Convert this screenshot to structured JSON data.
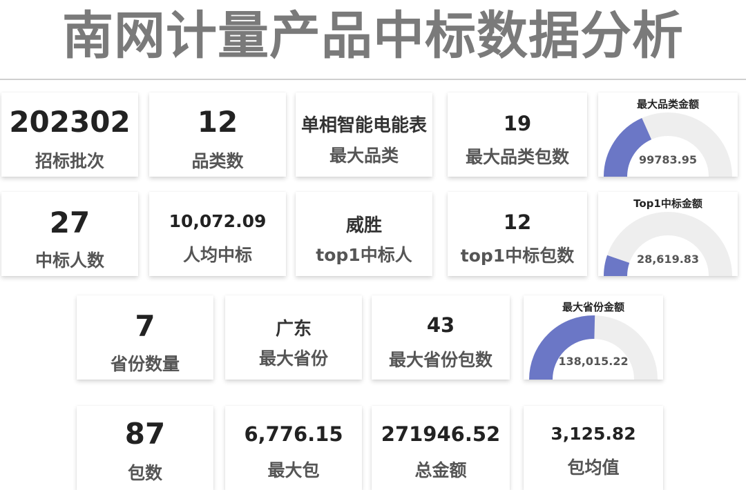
{
  "page": {
    "title": "南网计量产品中标数据分析"
  },
  "row1": [
    {
      "value": "202302",
      "label": "招标批次"
    },
    {
      "value": "12",
      "label": "品类数"
    },
    {
      "value": "单相智能电能表",
      "label": "最大品类"
    },
    {
      "value": "19",
      "label": "最大品类包数"
    }
  ],
  "row2": [
    {
      "value": "27",
      "label": "中标人数"
    },
    {
      "value": "10,072.09",
      "label": "人均中标"
    },
    {
      "value": "威胜",
      "label": "top1中标人"
    },
    {
      "value": "12",
      "label": "top1中标包数"
    }
  ],
  "row3": [
    {
      "value": "7",
      "label": "省份数量"
    },
    {
      "value": "广东",
      "label": "最大省份"
    },
    {
      "value": "43",
      "label": "最大省份包数"
    }
  ],
  "row4": [
    {
      "value": "87",
      "label": "包数"
    },
    {
      "value": "6,776.15",
      "label": "最大包"
    },
    {
      "value": "271946.52",
      "label": "总金额"
    },
    {
      "value": "3,125.82",
      "label": "包均值"
    }
  ],
  "chart_data": [
    {
      "type": "gauge",
      "title": "最大品类金额",
      "value_label": "99783.95",
      "value": 99783.95,
      "max": 271946.52,
      "fill_color": "#6b77c6",
      "track_color": "#eeeeee"
    },
    {
      "type": "gauge",
      "title": "Top1中标金额",
      "value_label": "28,619.83",
      "value": 28619.83,
      "max": 271946.52,
      "fill_color": "#6b77c6",
      "track_color": "#eeeeee"
    },
    {
      "type": "gauge",
      "title": "最大省份金额",
      "value_label": "138,015.22",
      "value": 138015.22,
      "max": 271946.52,
      "fill_color": "#6b77c6",
      "track_color": "#eeeeee"
    }
  ]
}
